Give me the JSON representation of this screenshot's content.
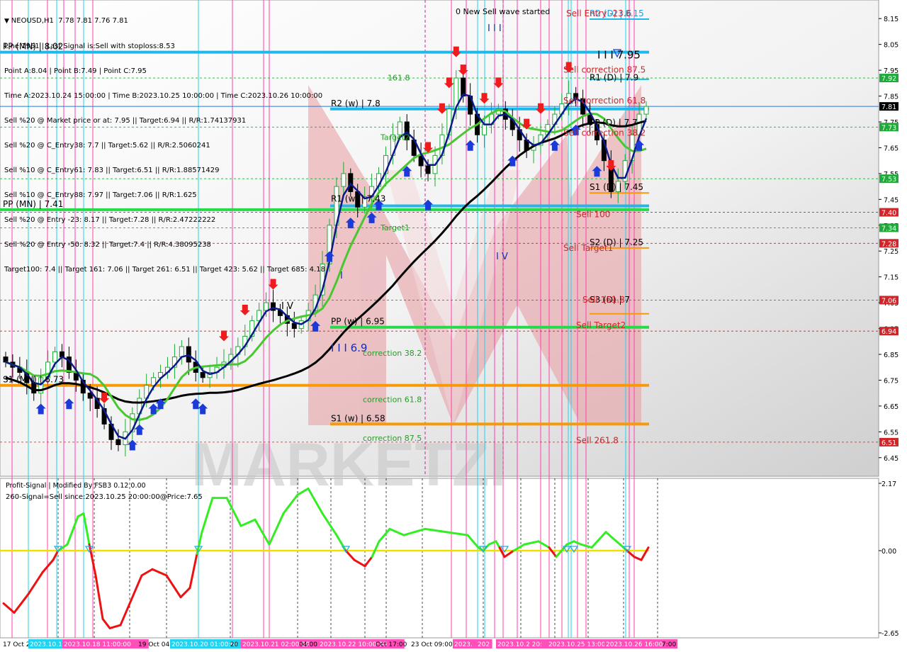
{
  "header": {
    "title": "NEOUSD,H1",
    "ohlc": "7.78 7.81 7.76 7.81",
    "wave_note": "0 New Sell wave started",
    "info_lines": [
      "Line:1961 | Last Signal is:Sell with stoploss:8.53",
      "Point A:8.04 | Point B:7.49 | Point C:7.95",
      "Time A:2023.10.24 15:00:00 | Time B:2023.10.25 10:00:00 | Time C:2023.10.26 10:00:00",
      "Sell %20 @ Market price or at: 7.95 || Target:6.94 || R/R:1.74137931",
      "Sell %20 @ C_Entry38: 7.7 || Target:5.62 || R/R:2.5060241",
      "Sell %10 @ C_Entry61: 7.83 || Target:6.51 || R/R:1.88571429",
      "Sell %10 @ C_Entry88: 7.97 || Target:7.06 || R/R:1.625",
      "Sell %20 @ Entry -23: 8.17 || Target:7.28 || R/R:2.47222222",
      "Sell %20 @ Entry -50: 8.32 || Target:7.4 || R/R:4.38095238",
      "Target100: 7.4 || Target 161: 7.06 || Target 261: 6.51 || Target 423: 5.62 || Target 685: 4.18"
    ]
  },
  "price_axis": {
    "min": 6.4,
    "max": 8.2,
    "ticks": [
      "8.15",
      "8.05",
      "7.95",
      "7.85",
      "7.75",
      "7.65",
      "7.55",
      "7.45",
      "7.35",
      "7.25",
      "7.15",
      "7.05",
      "6.95",
      "6.85",
      "6.75",
      "6.65",
      "6.55",
      "6.45"
    ],
    "badges": [
      {
        "text": "7.92",
        "value": 7.92,
        "color": "#1faa3a"
      },
      {
        "text": "7.81",
        "value": 7.81,
        "color": "#000000"
      },
      {
        "text": "7.73",
        "value": 7.73,
        "color": "#1faa3a"
      },
      {
        "text": "7.53",
        "value": 7.53,
        "color": "#1faa3a"
      },
      {
        "text": "7.40",
        "value": 7.4,
        "color": "#d0262a"
      },
      {
        "text": "7.34",
        "value": 7.34,
        "color": "#1faa3a"
      },
      {
        "text": "7.28",
        "value": 7.28,
        "color": "#d0262a"
      },
      {
        "text": "7.06",
        "value": 7.06,
        "color": "#d0262a"
      },
      {
        "text": "6.94",
        "value": 6.94,
        "color": "#d0262a"
      },
      {
        "text": "6.51",
        "value": 6.51,
        "color": "#d0262a"
      }
    ]
  },
  "levels": [
    {
      "label": "R2 (D) | 8.15",
      "value": 8.148,
      "color": "#1f9be0",
      "kind": "orange-thin",
      "side": "right"
    },
    {
      "label": "Sell Entry -23.6",
      "value": 8.148,
      "color": "#d0262a",
      "kind": "label",
      "side": "right"
    },
    {
      "label": "I I I 7.95",
      "value": 7.985,
      "color": "#000000",
      "kind": "label",
      "side": "right"
    },
    {
      "label": "PP (MN) | 8.02",
      "value": 8.02,
      "color": "#000000",
      "kind": "label",
      "side": "left"
    },
    {
      "label": "R1 (D) | 7.9",
      "value": 7.9,
      "color": "#000000",
      "kind": "label",
      "side": "right"
    },
    {
      "label": "Sell correction 87.5",
      "value": 7.93,
      "color": "#d0262a",
      "kind": "label",
      "side": "right"
    },
    {
      "label": "R2 (w) | 7.8",
      "value": 7.8,
      "color": "#000000",
      "kind": "label",
      "side": "mid"
    },
    {
      "label": "Sell correction 61.8",
      "value": 7.81,
      "color": "#d0262a",
      "kind": "label",
      "side": "right"
    },
    {
      "label": "PP (D) | 7.7",
      "value": 7.725,
      "color": "#000000",
      "kind": "label",
      "side": "right"
    },
    {
      "label": "Sell correction 38.2",
      "value": 7.685,
      "color": "#d0262a",
      "kind": "label",
      "side": "right"
    },
    {
      "label": "S1 (D) | 7.45",
      "value": 7.475,
      "color": "#000000",
      "kind": "label",
      "side": "right"
    },
    {
      "label": "R1 (w) | 7.43",
      "value": 7.43,
      "color": "#000000",
      "kind": "label",
      "side": "mid"
    },
    {
      "label": "PP (MN) | 7.41",
      "value": 7.41,
      "color": "#000000",
      "kind": "label",
      "side": "left"
    },
    {
      "label": "Sell 100",
      "value": 7.37,
      "color": "#d0262a",
      "kind": "label",
      "side": "right"
    },
    {
      "label": "S2 (D) | 7.25",
      "value": 7.262,
      "color": "#000000",
      "kind": "label",
      "side": "right"
    },
    {
      "label": "Sell Target1",
      "value": 7.24,
      "color": "#d0262a",
      "kind": "label",
      "side": "right"
    },
    {
      "label": "S3 (D) | 7",
      "value": 7.04,
      "color": "#000000",
      "kind": "label",
      "side": "right"
    },
    {
      "label": "Sell 161.8",
      "value": 7.04,
      "color": "#d0262a",
      "kind": "label",
      "side": "right"
    },
    {
      "label": "PP (w) | 6.95",
      "value": 6.955,
      "color": "#000000",
      "kind": "label",
      "side": "mid"
    },
    {
      "label": "Sell Target2",
      "value": 6.94,
      "color": "#d0262a",
      "kind": "label",
      "side": "right"
    },
    {
      "label": "I I I 6.9",
      "value": 6.85,
      "color": "#1030c0",
      "kind": "label",
      "side": "mid"
    },
    {
      "label": "S1 (MN) | 6.73",
      "value": 6.73,
      "color": "#000000",
      "kind": "label",
      "side": "left"
    },
    {
      "label": "S1 (w) | 6.58",
      "value": 6.58,
      "color": "#000000",
      "kind": "label",
      "side": "mid"
    },
    {
      "label": "Sell 261.8",
      "value": 6.495,
      "color": "#d0262a",
      "kind": "label",
      "side": "right"
    }
  ],
  "fib_labels": [
    {
      "label": "161.8",
      "value": 7.91,
      "color": "#2a9a2a"
    },
    {
      "label": "Target2",
      "value": 7.68,
      "color": "#2a9a2a"
    },
    {
      "label": "Target1",
      "value": 7.33,
      "color": "#2a9a2a"
    },
    {
      "label": "correction 38.2",
      "value": 6.845,
      "color": "#2a9a2a"
    },
    {
      "label": "correction 61.8",
      "value": 6.665,
      "color": "#2a9a2a"
    },
    {
      "label": "correction 87.5",
      "value": 6.515,
      "color": "#2a9a2a"
    }
  ],
  "wave_marks": [
    {
      "label": "I I I",
      "value": 8.11,
      "color": "#1030c0",
      "pos": "upper"
    },
    {
      "label": "I V",
      "value": 7.22,
      "color": "#1030c0",
      "pos": "mid"
    },
    {
      "label": "I V",
      "value": 7.05,
      "color": "#000000",
      "pos": "left"
    },
    {
      "label": "I",
      "value": 7.16,
      "color": "#1030c0",
      "pos": "up"
    }
  ],
  "watermark": "MARKETZI",
  "oscillator": {
    "title": "Profit-Signal | Modified By FSB3 0.12 0.00",
    "signal_text": "260-Signal=Sell since:2023.10.25 20:00:00@Price:7.65",
    "max": 2.17,
    "min": -2.65,
    "ticks": [
      "2.17",
      "0.00",
      "-2.65"
    ],
    "zero_color": "#f0e000"
  },
  "time_axis": {
    "labels": [
      {
        "text": "17 Oct 2023",
        "highlight": false
      },
      {
        "text": "2023.10.17",
        "highlight": true
      },
      {
        "text": "2023.10.18 11:00:00",
        "highlight": true
      },
      {
        "text": "19 Oct 04:00",
        "highlight": false
      },
      {
        "text": "2023.10.20 01:00:00",
        "highlight": true
      },
      {
        "text": "20 Oct",
        "highlight": false
      },
      {
        "text": "2023.10.21 02:00:00",
        "highlight": true
      },
      {
        "text": "04:00",
        "highlight": false
      },
      {
        "text": "2023.10.22 10:00:00",
        "highlight": true
      },
      {
        "text": "Oct 17:00",
        "highlight": false
      },
      {
        "text": "23 Oct 09:00",
        "highlight": false
      },
      {
        "text": "2023.",
        "highlight": true
      },
      {
        "text": "202",
        "highlight": true
      },
      {
        "text": "2023.10.2 20:",
        "highlight": true
      },
      {
        "text": "2023.10.25 13:00",
        "highlight": true
      },
      {
        "text": "2023.10.26 16:00",
        "highlight": true
      },
      {
        "text": "7:00",
        "highlight": false
      }
    ]
  },
  "colors": {
    "up_candle": "#1faa3a",
    "down_candle": "#000000",
    "ma_fast": "#0a1a8a",
    "ma_mid": "#48c830",
    "ma_slow": "#000000",
    "level_blue": "#1fb8e8",
    "level_green": "#27d94b",
    "level_orange": "#f79a0a",
    "vline_pink": "#ff3fae",
    "vline_cyan": "#22d2ee",
    "osc_green": "#33ee22",
    "osc_red": "#ee1111"
  },
  "chart_data": {
    "type": "candlestick",
    "symbol": "NEOUSD",
    "timeframe": "H1",
    "ylim": [
      6.4,
      8.2
    ],
    "close_path": [
      6.82,
      6.8,
      6.78,
      6.74,
      6.7,
      6.76,
      6.82,
      6.86,
      6.84,
      6.78,
      6.75,
      6.7,
      6.68,
      6.64,
      6.58,
      6.52,
      6.5,
      6.55,
      6.62,
      6.68,
      6.73,
      6.76,
      6.78,
      6.8,
      6.84,
      6.88,
      6.82,
      6.78,
      6.76,
      6.78,
      6.8,
      6.82,
      6.85,
      6.88,
      6.92,
      6.98,
      7.02,
      7.05,
      7.02,
      7.0,
      6.97,
      6.95,
      6.98,
      7.02,
      7.08,
      7.2,
      7.35,
      7.5,
      7.55,
      7.48,
      7.42,
      7.46,
      7.5,
      7.55,
      7.62,
      7.7,
      7.75,
      7.68,
      7.62,
      7.58,
      7.55,
      7.62,
      7.7,
      7.8,
      7.92,
      7.85,
      7.78,
      7.7,
      7.74,
      7.78,
      7.8,
      7.76,
      7.72,
      7.68,
      7.64,
      7.66,
      7.7,
      7.74,
      7.78,
      7.82,
      7.86,
      7.84,
      7.78,
      7.74,
      7.68,
      7.6,
      7.48,
      7.52,
      7.6,
      7.7,
      7.78,
      7.81
    ]
  }
}
